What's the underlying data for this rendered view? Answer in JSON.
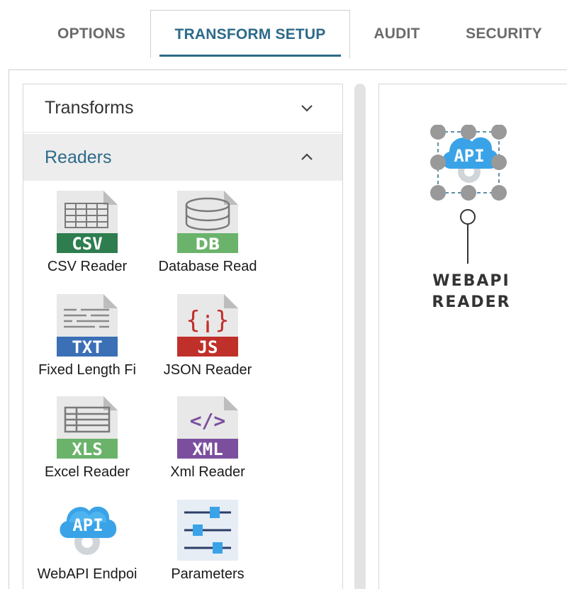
{
  "tabs": [
    {
      "label": "OPTIONS",
      "active": false
    },
    {
      "label": "TRANSFORM SETUP",
      "active": true
    },
    {
      "label": "AUDIT",
      "active": false
    },
    {
      "label": "SECURITY",
      "active": false
    }
  ],
  "palette": {
    "sections": [
      {
        "title": "Transforms",
        "expanded": false,
        "chevron": "chevron-down-icon"
      },
      {
        "title": "Readers",
        "expanded": true,
        "chevron": "chevron-up-icon"
      }
    ],
    "readers": [
      {
        "label": "CSV Reader",
        "icon": "csv-file-icon",
        "badge": "CSV",
        "badge_color": "#2e7d4f"
      },
      {
        "label": "Database Read",
        "icon": "db-file-icon",
        "badge": "DB",
        "badge_color": "#6bb36b"
      },
      {
        "label": "Fixed Length Fi",
        "icon": "txt-file-icon",
        "badge": "TXT",
        "badge_color": "#3b6fb6"
      },
      {
        "label": "JSON Reader",
        "icon": "js-file-icon",
        "badge": "JS",
        "badge_color": "#c0302a"
      },
      {
        "label": "Excel Reader",
        "icon": "xls-file-icon",
        "badge": "XLS",
        "badge_color": "#6bb36b"
      },
      {
        "label": "Xml Reader",
        "icon": "xml-file-icon",
        "badge": "XML",
        "badge_color": "#7b4f9e"
      },
      {
        "label": "WebAPI Endpoi",
        "icon": "api-cloud-icon",
        "badge": "API",
        "badge_color": "#3aa3e8"
      },
      {
        "label": "Parameters",
        "icon": "parameters-sliders-icon",
        "badge": "",
        "badge_color": "#2d5ea8"
      }
    ]
  },
  "canvas": {
    "node": {
      "icon": "api-cloud-icon",
      "badge": "API",
      "label_line1": "WEBAPI",
      "label_line2": "READER"
    }
  },
  "colors": {
    "accent": "#2d6a8a",
    "selection_handle": "#999999"
  }
}
